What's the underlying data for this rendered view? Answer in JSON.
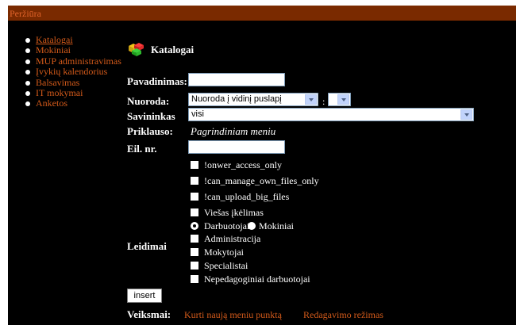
{
  "window": {
    "title": "Peržiūra"
  },
  "sidebar": {
    "items": [
      {
        "label": "Katalogai",
        "active": true
      },
      {
        "label": "Mokiniai"
      },
      {
        "label": "MUP administravimas"
      },
      {
        "label": "Įvykių kalendorius"
      },
      {
        "label": "Balsavimas"
      },
      {
        "label": "IT mokymai"
      },
      {
        "label": "Anketos"
      }
    ]
  },
  "header": {
    "title": "Katalogai",
    "icon": "catalog-blocks-icon"
  },
  "form": {
    "pavadinimas": {
      "label": "Pavadinimas:",
      "value": ""
    },
    "nuoroda": {
      "label": "Nuoroda:",
      "value": "Nuoroda į vidinį puslapį",
      "separator": ":",
      "secondary_value": ""
    },
    "savininkas": {
      "label": "Savininkas",
      "value": "visi"
    },
    "priklauso": {
      "label": "Priklauso:",
      "value": "Pagrindiniam meniu"
    },
    "eil_nr": {
      "label": "Eil. nr.",
      "value": ""
    },
    "leidimai": {
      "label": "Leidimai",
      "options": [
        "!onwer_access_only",
        "!can_manage_own_files_only",
        "!can_upload_big_files",
        "Viešas įkėlimas"
      ],
      "radio": {
        "options": [
          "Darbuotojai",
          "Mokiniai"
        ],
        "selected": "Darbuotojai"
      },
      "groups": [
        "Administracija",
        "Mokytojai",
        "Specialistai",
        "Nepedagoginiai darbuotojai"
      ]
    }
  },
  "actions": {
    "insert_label": "insert",
    "veiksmai_label": "Veiksmai:",
    "links": [
      "Kurti naują meniu punktą",
      "Redagavimo režimas"
    ]
  },
  "colors": {
    "background": "#000000",
    "titlebar": "#7a2a00",
    "link": "#d35a1a"
  }
}
